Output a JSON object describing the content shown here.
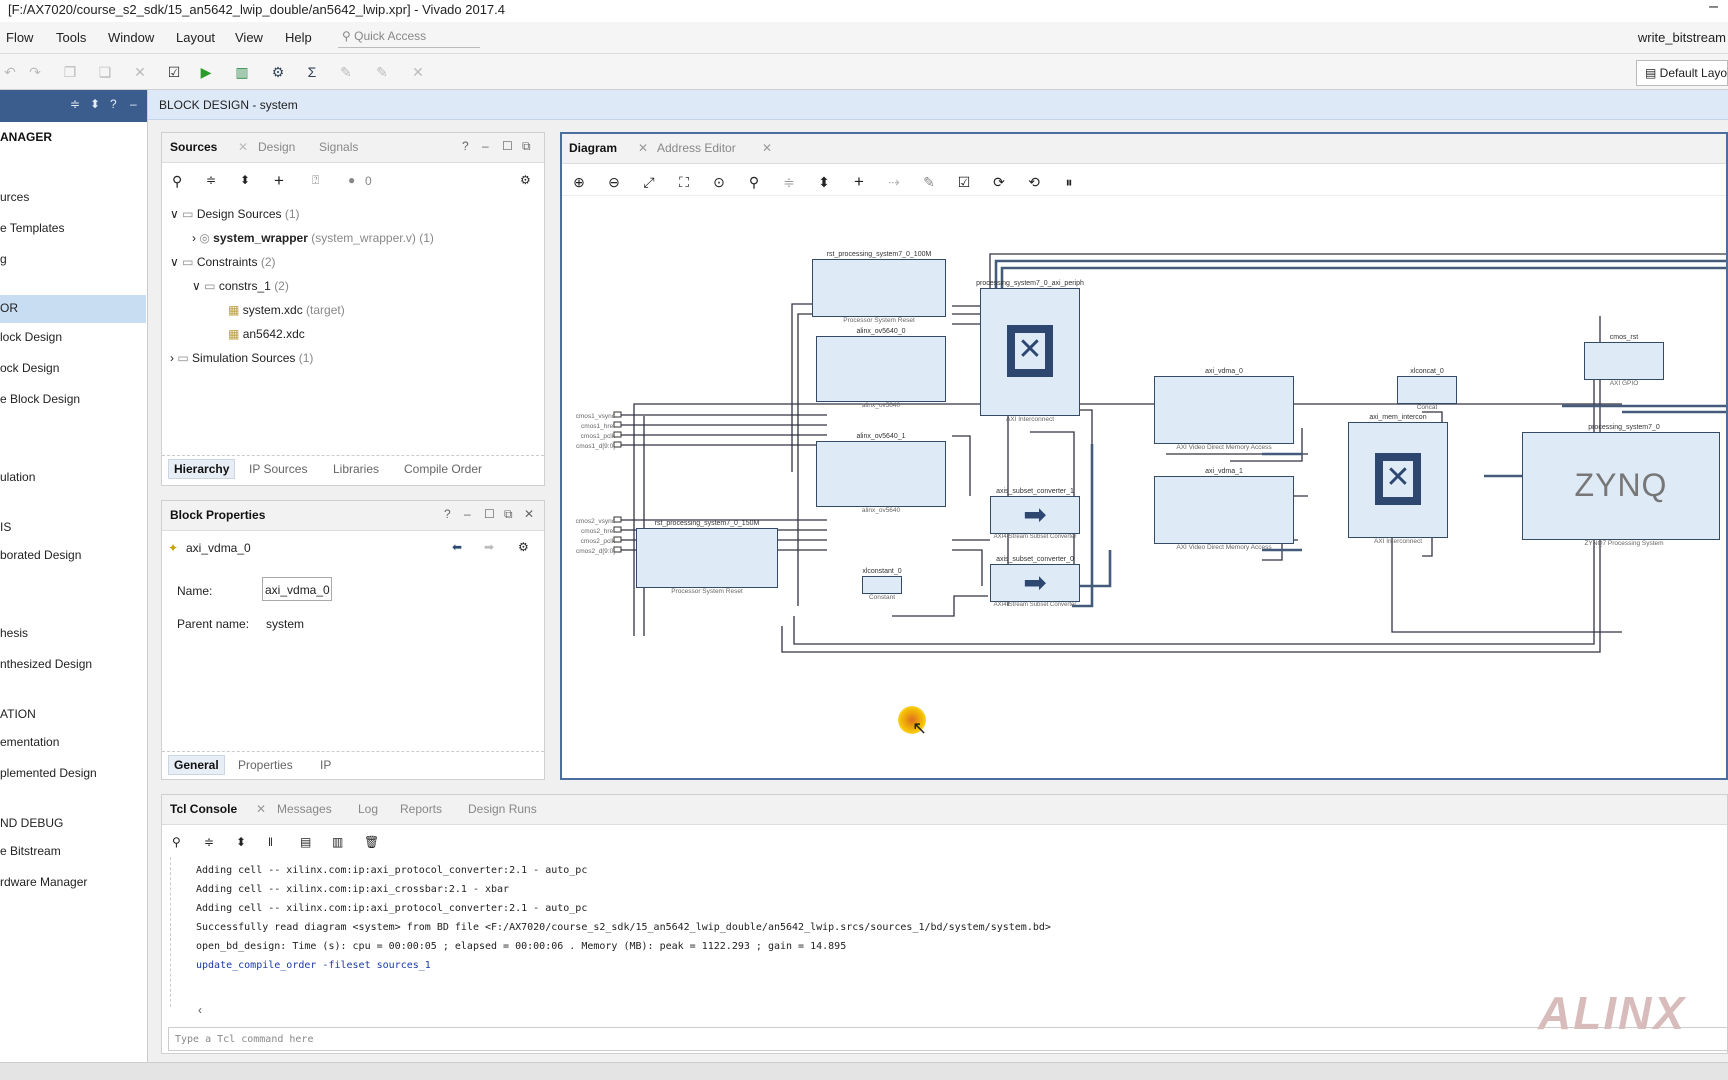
{
  "window": {
    "title": "[F:/AX7020/course_s2_sdk/15_an5642_lwip_double/an5642_lwip.xpr] - Vivado 2017.4",
    "minimize": "–"
  },
  "menu": {
    "items": [
      "Flow",
      "Tools",
      "Window",
      "Layout",
      "View",
      "Help"
    ],
    "quick_access": "Quick Access",
    "right_status": "write_bitstream"
  },
  "toolbar": {
    "layout": "Default Layout"
  },
  "left_panel": {
    "items": [
      "ANAGER",
      "urces",
      "e Templates",
      "g",
      "OR",
      "lock Design",
      "ock Design",
      "e Block Design",
      "ulation",
      "IS",
      "borated Design",
      "hesis",
      "nthesized Design",
      "ATION",
      "ementation",
      "plemented Design",
      "ND DEBUG",
      "e Bitstream",
      "rdware Manager"
    ]
  },
  "block_design": {
    "label": "BLOCK DESIGN",
    "name": "system"
  },
  "sources": {
    "tabs": [
      "Sources",
      "Design",
      "Signals"
    ],
    "count": "0",
    "design_sources": "Design Sources",
    "design_sources_count": "(1)",
    "wrapper": "system_wrapper",
    "wrapper_file": "(system_wrapper.v) (1)",
    "constraints": "Constraints",
    "constraints_count": "(2)",
    "constrs": "constrs_1",
    "constrs_count": "(2)",
    "xdc1": "system.xdc",
    "xdc1_tag": "(target)",
    "xdc2": "an5642.xdc",
    "sim": "Simulation Sources",
    "sim_count": "(1)",
    "bottom_tabs": [
      "Hierarchy",
      "IP Sources",
      "Libraries",
      "Compile Order"
    ]
  },
  "block_properties": {
    "title": "Block Properties",
    "selected": "axi_vdma_0",
    "name_label": "Name:",
    "name_value": "axi_vdma_0",
    "parent_label": "Parent name:",
    "parent_value": "system",
    "bottom_tabs": [
      "General",
      "Properties",
      "IP"
    ]
  },
  "diagram": {
    "tabs": [
      "Diagram",
      "Address Editor"
    ],
    "ports1": [
      "cmos1_vsync",
      "cmos1_href",
      "cmos1_pclk",
      "cmos1_d[9:0]"
    ],
    "ports2": [
      "cmos2_vsync",
      "cmos2_href",
      "cmos2_pclk",
      "cmos2_d[9:0]"
    ],
    "blocks": {
      "rst100": {
        "name": "rst_processing_system7_0_100M",
        "sub": "Processor System Reset"
      },
      "ov0": {
        "name": "alinx_ov5640_0",
        "sub": "alinx_ov5640"
      },
      "ov1": {
        "name": "alinx_ov5640_1",
        "sub": "alinx_ov5640"
      },
      "rst150": {
        "name": "rst_processing_system7_0_150M",
        "sub": "Processor System Reset"
      },
      "periph": {
        "name": "processing_system7_0_axi_periph",
        "sub": "AXI Interconnect"
      },
      "conv1": {
        "name": "axis_subset_converter_1",
        "sub": "AXI4-Stream Subset Converter"
      },
      "conv0": {
        "name": "axis_subset_converter_0",
        "sub": "AXI4-Stream Subset Converter"
      },
      "const": {
        "name": "xlconstant_0",
        "sub": "Constant"
      },
      "vdma0": {
        "name": "axi_vdma_0",
        "sub": "AXI Video Direct Memory Access"
      },
      "vdma1": {
        "name": "axi_vdma_1",
        "sub": "AXI Video Direct Memory Access"
      },
      "concat": {
        "name": "xlconcat_0",
        "sub": "Concat"
      },
      "mem": {
        "name": "axi_mem_intercon",
        "sub": "AXI Interconnect"
      },
      "gpio": {
        "name": "cmos_rst",
        "sub": "AXI GPIO"
      },
      "ps": {
        "name": "processing_system7_0",
        "sub": "ZYNQ7 Processing System",
        "logo": "ZYNQ"
      }
    }
  },
  "tcl": {
    "tabs": [
      "Tcl Console",
      "Messages",
      "Log",
      "Reports",
      "Design Runs"
    ],
    "lines": [
      "Adding cell -- xilinx.com:ip:axi_protocol_converter:2.1 - auto_pc",
      "Adding cell -- xilinx.com:ip:axi_crossbar:2.1 - xbar",
      "Adding cell -- xilinx.com:ip:axi_protocol_converter:2.1 - auto_pc",
      "Successfully read diagram <system> from BD file <F:/AX7020/course_s2_sdk/15_an5642_lwip_double/an5642_lwip.srcs/sources_1/bd/system/system.bd>",
      "open_bd_design: Time (s): cpu = 00:00:05 ; elapsed = 00:00:06 . Memory (MB): peak = 1122.293 ; gain = 14.895",
      "update_compile_order -fileset sources_1"
    ],
    "placeholder": "Type a Tcl command here"
  },
  "watermark": "ALINX"
}
